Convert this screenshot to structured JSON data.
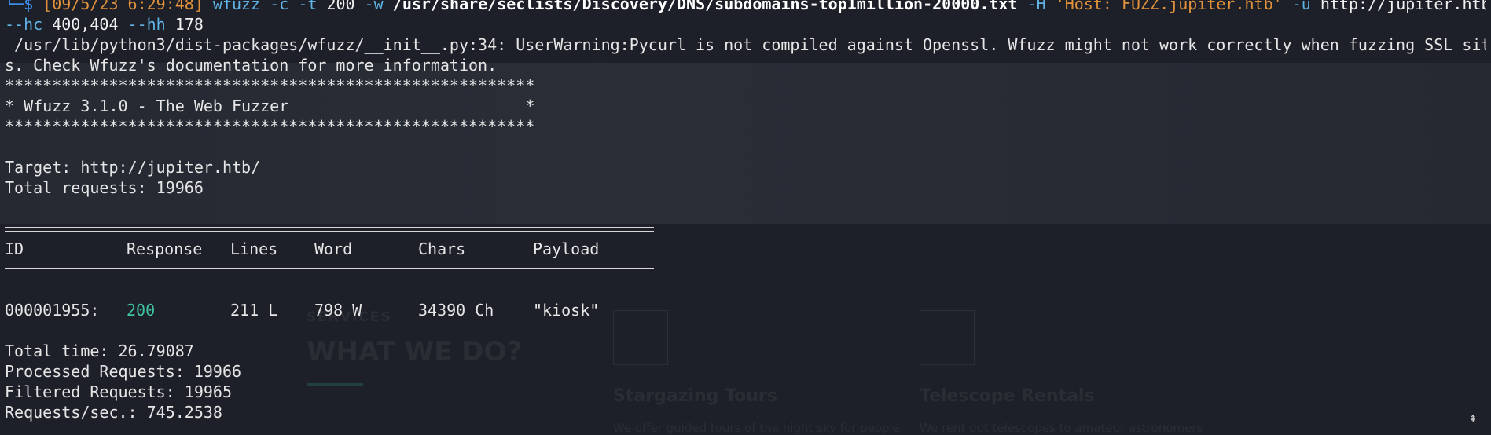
{
  "prompt": {
    "corner": "└─$",
    "timestamp": "[09/5/23 6:29:48]",
    "cmd": "wfuzz",
    "flag_c": "-c",
    "flag_t": "-t",
    "threads": "200",
    "flag_w": "-w",
    "wordlist": "/usr/share/seclists/Discovery/DNS/subdomains-top1million-20000.txt",
    "flag_H": "-H",
    "header": "'Host: FUZZ.jupiter.htb'",
    "flag_u": "-u",
    "url": "http://jupiter.htb",
    "flag_hc": "--hc",
    "hc_value": "400,404",
    "flag_hh": "--hh",
    "hh_value": "178"
  },
  "warning": {
    "line1": " /usr/lib/python3/dist-packages/wfuzz/__init__.py:34: UserWarning:Pycurl is not compiled against Openssl. Wfuzz might not work correctly when fuzzing SSL site",
    "line2": "s. Check Wfuzz's documentation for more information."
  },
  "banner": {
    "stars": "********************************************************",
    "title": "* Wfuzz 3.1.0 - The Web Fuzzer                         *"
  },
  "info": {
    "target": "Target: http://jupiter.htb/",
    "total": "Total requests: 19966"
  },
  "table": {
    "headers": {
      "id": "ID",
      "response": "Response",
      "lines": "Lines",
      "word": "Word",
      "chars": "Chars",
      "payload": "Payload"
    },
    "row": {
      "id": "000001955:",
      "response": "200",
      "lines": "211 L",
      "word": "798 W",
      "chars": "34390 Ch",
      "payload": "\"kiosk\""
    }
  },
  "summary": {
    "time": "Total time: 26.79087",
    "processed": "Processed Requests: 19966",
    "filtered": "Filtered Requests: 19965",
    "rate": "Requests/sec.: 745.2538"
  },
  "background": {
    "services": "SERVICES",
    "heading": "WHAT WE DO?",
    "card1_title": "Stargazing Tours",
    "card1_text": "We offer guided tours of the night sky for people",
    "card2_title": "Telescope Rentals",
    "card2_text": "We rent out telescopes to amateur astronomers"
  },
  "icons": {
    "scroll": "scroll-indicator-icon"
  }
}
